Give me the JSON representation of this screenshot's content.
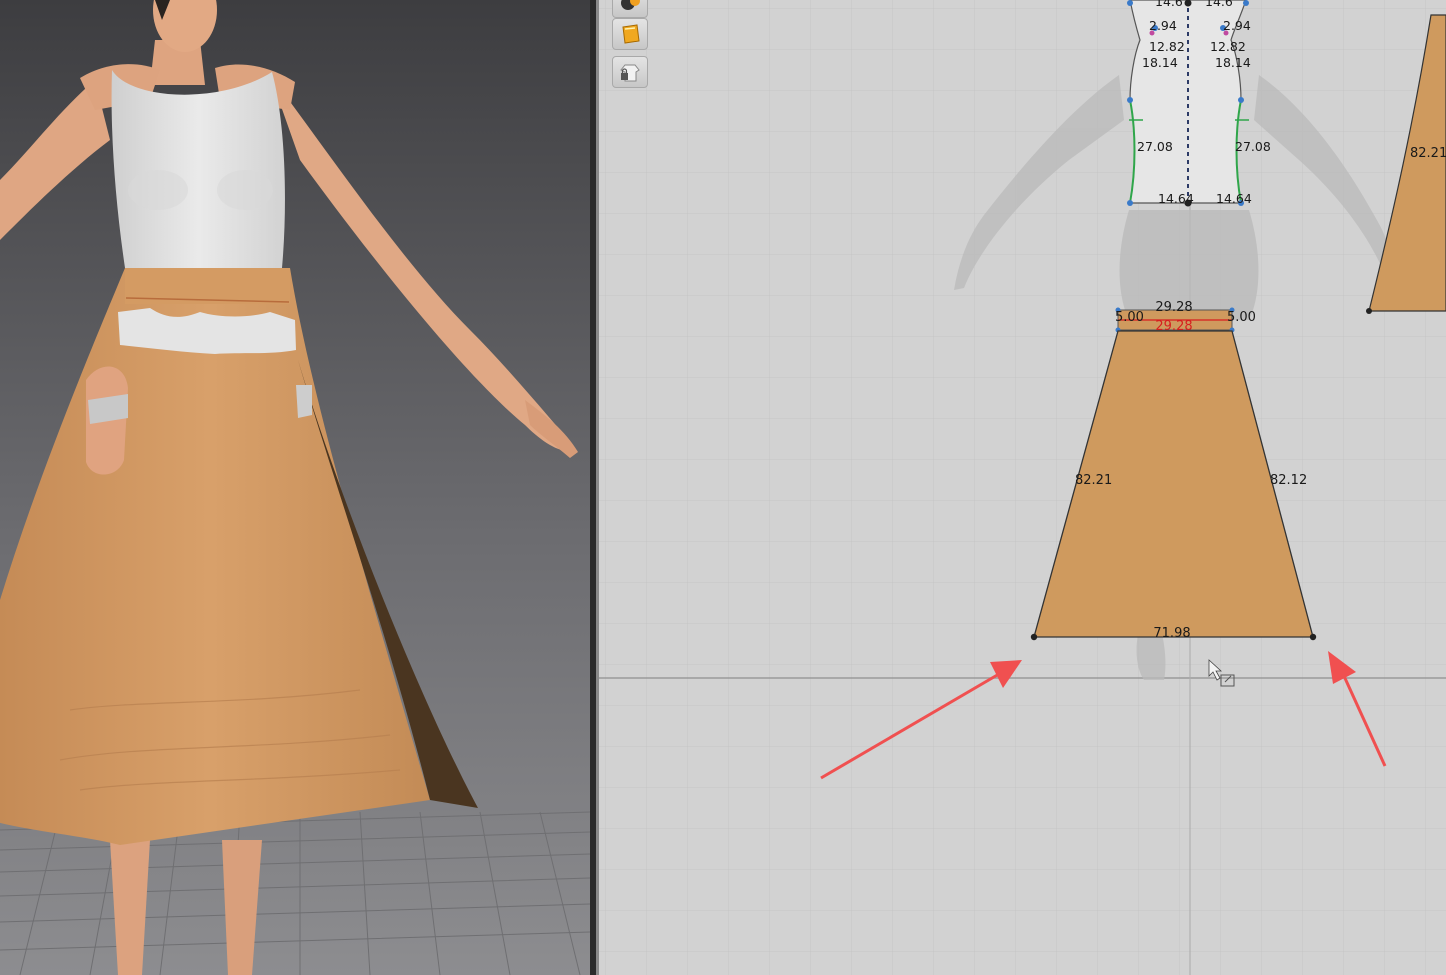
{
  "viewport_3d": {
    "avatar": "female-avatar",
    "garment": {
      "top": "white sleeveless bodice",
      "skirt": "orange flared skirt"
    },
    "colors": {
      "background_top": "#3d3d40",
      "background_bottom": "#8d8d90",
      "skin": "#e0a885",
      "top": "#e3e3e3",
      "skirt": "#d39a63",
      "skirt_shadow": "#4a3520"
    }
  },
  "toolbar": {
    "icons": [
      {
        "name": "avatar-display-icon"
      },
      {
        "name": "fabric-icon"
      },
      {
        "name": "lock-garment-icon"
      }
    ]
  },
  "pattern_window": {
    "colors": {
      "background": "#d2d2d2",
      "grid_line": "#c5c5c5",
      "axis": "#9a9a9a",
      "pattern_fill": "#cf9a5e",
      "bodice_fill": "#e6e6e6",
      "arrow": "#f05050",
      "seam_green": "#2fa64a",
      "measure_red": "#d71f1f"
    },
    "bodice_measurements": {
      "top_left": "14.6",
      "top_right": "14.6",
      "neck_left": "2.94",
      "neck_right": "2.94",
      "mid_left": "12.82",
      "mid_right": "12.82",
      "shoulder_left": "18.14",
      "shoulder_right": "18.14",
      "side_left": "27.08",
      "side_right": "27.08",
      "waist_left": "14.64",
      "waist_right": "14.64"
    },
    "skirt_measurements": {
      "waistband_top": "29.28",
      "waistband_bottom": "29.28",
      "waistband_left": "5.00",
      "waistband_right": "5.00",
      "left_side": "82.21",
      "right_side": "82.12",
      "hem": "71.98"
    },
    "right_piece_measurement": "82.21"
  }
}
